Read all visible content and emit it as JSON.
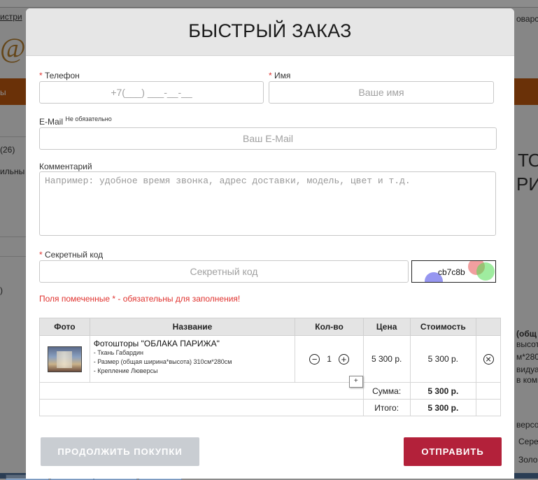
{
  "background": {
    "link_top_left": "истри",
    "link_top_right": "оварс",
    "count": "(26)",
    "side_left": "ильны",
    "side_left_small": "ы",
    "side_left_paren": ")",
    "right_big_1": "ТО",
    "right_big_2": "РИЖ",
    "right_lines": [
      "(общ",
      "высот",
      "м*280",
      "видуа",
      "в комм"
    ],
    "right_bottom_1": "версо",
    "right_bottom_2": "Сере",
    "right_bottom_3": "Золо"
  },
  "modal": {
    "title": "БЫСТРЫЙ ЗАКАЗ",
    "phone": {
      "label": "Телефон",
      "required_mark": "*",
      "placeholder": "+7(___) ___-__-__"
    },
    "name": {
      "label": "Имя",
      "required_mark": "*",
      "placeholder": "Ваше имя"
    },
    "email": {
      "label": "E-Mail",
      "optional_note": "Не обязательно",
      "placeholder": "Ваш E-Mail"
    },
    "comment": {
      "label": "Комментарий",
      "placeholder": "Например: удобное время звонка, адрес доставки, модель, цвет и т.д."
    },
    "secret": {
      "label": "Секретный код",
      "required_mark": "*",
      "placeholder": "Секретный код",
      "captcha_text": "cb7c8b"
    },
    "required_note": "Поля помеченные * - обязательны для заполнения!",
    "table": {
      "headers": [
        "Фото",
        "Название",
        "Кол-во",
        "Цена",
        "Стоимость"
      ],
      "item": {
        "name": "Фотошторы \"ОБЛАКА ПАРИЖА\"",
        "details": [
          "- Ткань Габардин",
          "- Размер (общая ширина*высота) 310см*280см",
          "- Крепление Люверсы"
        ],
        "qty": "1",
        "minus_symbol": "−",
        "plus_symbol": "+",
        "tooltip": "+",
        "price": "5 300 р.",
        "cost": "5 300 р.",
        "remove_symbol": "×"
      },
      "sum_label": "Сумма:",
      "sum_value": "5 300 р.",
      "total_label": "Итого:",
      "total_value": "5 300 р."
    },
    "continue_button": "ПРОДОЛЖИТЬ ПОКУПКИ",
    "send_button": "ОТПРАВИТЬ"
  },
  "colors": {
    "required": "#e0332f",
    "send_button": "#b3213a",
    "continue_button": "#c9cdd2"
  }
}
